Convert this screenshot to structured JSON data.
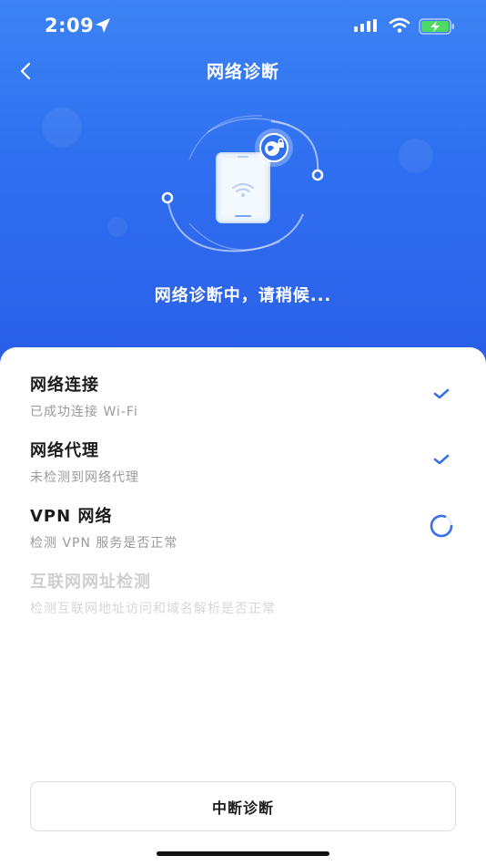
{
  "status_bar": {
    "time": "2:09"
  },
  "nav": {
    "title": "网络诊断"
  },
  "hero": {
    "status_text": "网络诊断中，请稍候..."
  },
  "checks": [
    {
      "title": "网络连接",
      "subtitle": "已成功连接 Wi-Fi",
      "state": "done"
    },
    {
      "title": "网络代理",
      "subtitle": "未检测到网络代理",
      "state": "done"
    },
    {
      "title": "VPN 网络",
      "subtitle": "检测 VPN 服务是否正常",
      "state": "checking"
    },
    {
      "title": "互联网网址检测",
      "subtitle": "检测互联网地址访问和域名解析是否正常",
      "state": "pending"
    }
  ],
  "actions": {
    "stop_label": "中断诊断"
  },
  "colors": {
    "primary": "#2f6ff0",
    "check": "#3a6fe6",
    "battery_charging": "#4cd964"
  }
}
